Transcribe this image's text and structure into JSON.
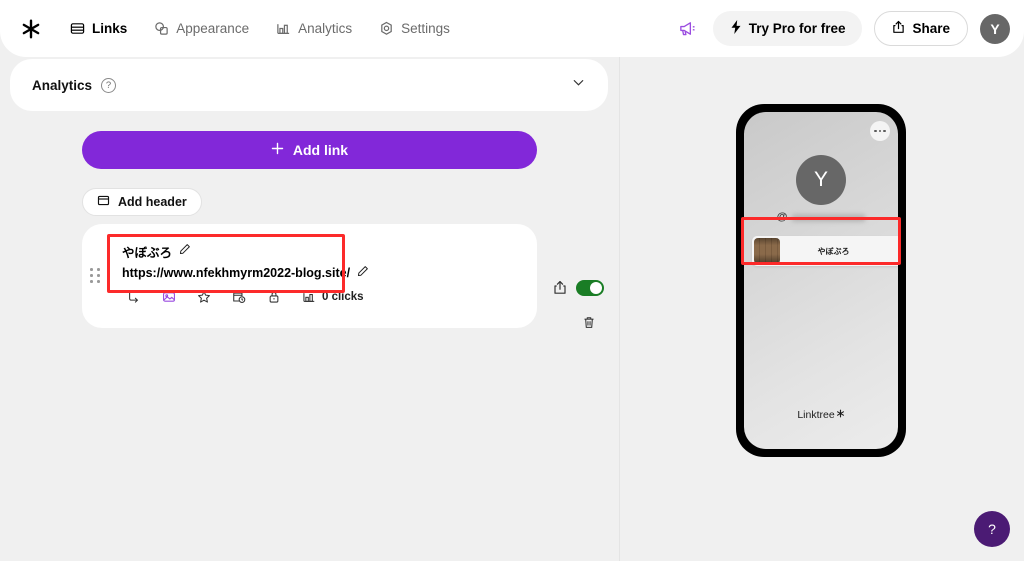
{
  "header": {
    "logo_icon": "linktree-asterisk-logo",
    "tabs": [
      {
        "label": "Links",
        "icon": "links-icon",
        "active": true
      },
      {
        "label": "Appearance",
        "icon": "appearance-icon",
        "active": false
      },
      {
        "label": "Analytics",
        "icon": "analytics-bars-icon",
        "active": false
      },
      {
        "label": "Settings",
        "icon": "settings-gear-icon",
        "active": false
      }
    ],
    "megaphone_icon": "megaphone-icon",
    "try_pro_label": "Try Pro for free",
    "try_pro_icon": "lightning-bolt-icon",
    "share_label": "Share",
    "share_icon": "share-upload-icon",
    "avatar_initial": "Y"
  },
  "analytics_panel": {
    "title": "Analytics",
    "help_glyph": "?",
    "chevron_icon": "chevron-down-icon"
  },
  "actions": {
    "add_link_label": "Add link",
    "add_link_icon": "plus-icon",
    "add_header_label": "Add header",
    "add_header_icon": "header-box-icon"
  },
  "link_card": {
    "title": "やぼぶろ",
    "url": "https://www.nfekhmyrm2022-blog.site/",
    "title_edit_icon": "pencil-icon",
    "url_edit_icon": "pencil-icon",
    "clicks_text": "0 clicks",
    "tools": [
      {
        "name": "layout-icon"
      },
      {
        "name": "image-icon"
      },
      {
        "name": "star-icon"
      },
      {
        "name": "schedule-icon"
      },
      {
        "name": "lock-icon"
      }
    ],
    "clicks_icon": "bar-chart-icon",
    "share_icon": "share-upload-icon",
    "delete_icon": "trash-icon",
    "toggle_on": true,
    "drag_handle_icon": "drag-handle-icon"
  },
  "preview": {
    "avatar_initial": "Y",
    "handle_prefix": "@",
    "handle_blurred": true,
    "menu_icon": "more-dots-icon",
    "link_title": "やぼぶろ",
    "thumbnail_icon": "link-thumbnail",
    "footer_label": "Linktree",
    "footer_icon": "asterisk-icon"
  },
  "help_button": {
    "glyph": "?"
  },
  "colors": {
    "brand_purple": "#8228d9",
    "toggle_green": "#1a7d25",
    "annotation_red": "#fc2a2a",
    "help_purple": "#4b1b74",
    "page_bg": "#f0f0f0",
    "avatar_gray": "#676767"
  }
}
